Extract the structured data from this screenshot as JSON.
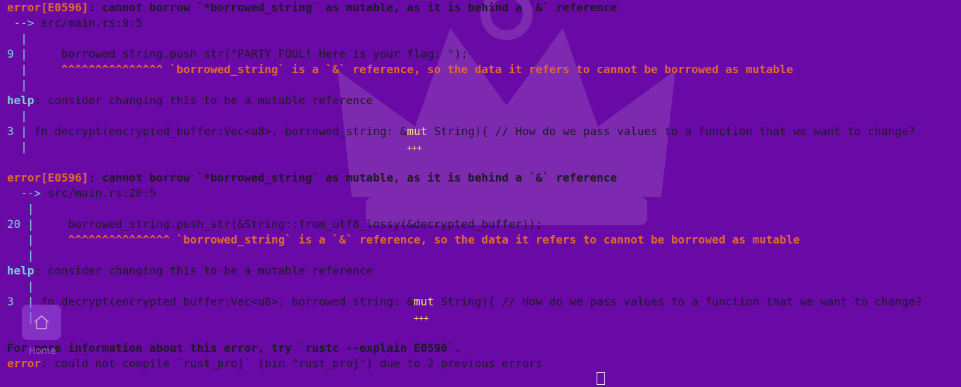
{
  "errors": [
    {
      "code": "error[E0596]",
      "message": ": cannot borrow `*borrowed_string` as mutable, as it is behind a `&` reference",
      "arrow": " --> ",
      "location": "src/main.rs:9:5",
      "line_no": "9",
      "source": "     borrowed_string.push_str(\"PARTY FOUL! Here is your flag: \");",
      "carets": "^^^^^^^^^^^^^^^ `borrowed_string` is a `&` reference, so the data it refers to cannot be borrowed as mutable",
      "help_word": "help",
      "help_text": ": consider changing this to be a mutable reference",
      "sugg_no": "3",
      "sugg_pre": "fn decrypt(encrypted_buffer:Vec<u8>, borrowed_string: &",
      "sugg_mut": "mut",
      "sugg_post": " String){ // How do we pass values to a function that we want to change?",
      "plus": "+++"
    },
    {
      "code": "error[E0596]",
      "message": ": cannot borrow `*borrowed_string` as mutable, as it is behind a `&` reference",
      "arrow": " --> ",
      "location": "src/main.rs:20:5",
      "line_no": "20",
      "source": "     borrowed_string.push_str(&String::from_utf8_lossy(&decrypted_buffer));",
      "carets": "^^^^^^^^^^^^^^^ `borrowed_string` is a `&` reference, so the data it refers to cannot be borrowed as mutable",
      "help_word": "help",
      "help_text": ": consider changing this to be a mutable reference",
      "sugg_no": "3",
      "sugg_pre": "fn decrypt(encrypted_buffer:Vec<u8>, borrowed_string: &",
      "sugg_mut": "mut",
      "sugg_post": " String){ // How do we pass values to a function that we want to change?",
      "plus": "+++"
    }
  ],
  "footer": {
    "more_info": "For more information about this error, try `rustc --explain E0596`.",
    "final_error_word": "error",
    "final_error_text": ": could not compile `rust_proj` (bin \"rust_proj\") due to 2 previous errors"
  },
  "home_widget": {
    "label": "Home",
    "icon": "home-icon"
  },
  "colors": {
    "background": "#6a0aa6",
    "error": "#e06a2c",
    "gutter": "#7ad0d6",
    "highlight": "#f2e37a"
  }
}
